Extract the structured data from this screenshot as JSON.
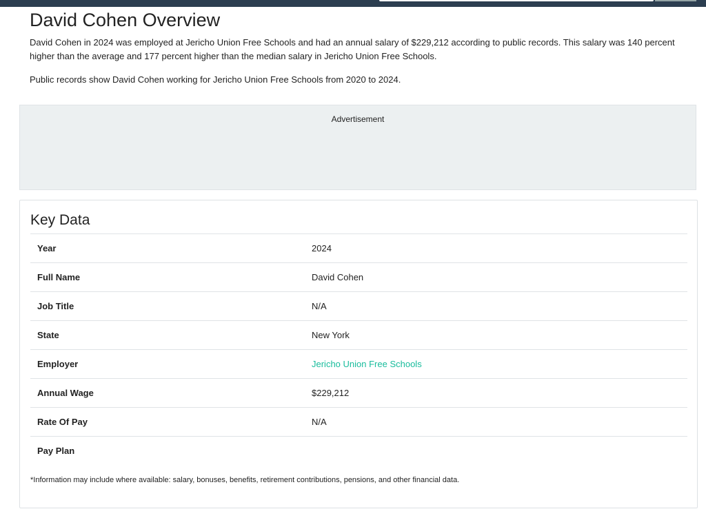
{
  "overview": {
    "title": "David Cohen Overview",
    "paragraph1": "David Cohen in 2024 was employed at Jericho Union Free Schools and had an annual salary of $229,212 according to public records. This salary was 140 percent higher than the average and 177 percent higher than the median salary in Jericho Union Free Schools.",
    "paragraph2": "Public records show David Cohen working for Jericho Union Free Schools from 2020 to 2024."
  },
  "ad": {
    "label": "Advertisement"
  },
  "key_data": {
    "title": "Key Data",
    "rows": [
      {
        "label": "Year",
        "value": "2024"
      },
      {
        "label": "Full Name",
        "value": "David Cohen"
      },
      {
        "label": "Job Title",
        "value": "N/A"
      },
      {
        "label": "State",
        "value": "New York"
      },
      {
        "label": "Employer",
        "value": "Jericho Union Free Schools"
      },
      {
        "label": "Annual Wage",
        "value": "$229,212"
      },
      {
        "label": "Rate Of Pay",
        "value": "N/A"
      },
      {
        "label": "Pay Plan",
        "value": ""
      }
    ],
    "footnote": "*Information may include where available: salary, bonuses, benefits, retirement contributions, pensions, and other financial data."
  },
  "colors": {
    "link": "#18bc9c",
    "navbar": "#2c3e50",
    "ad_bg": "#ecf0f1"
  }
}
